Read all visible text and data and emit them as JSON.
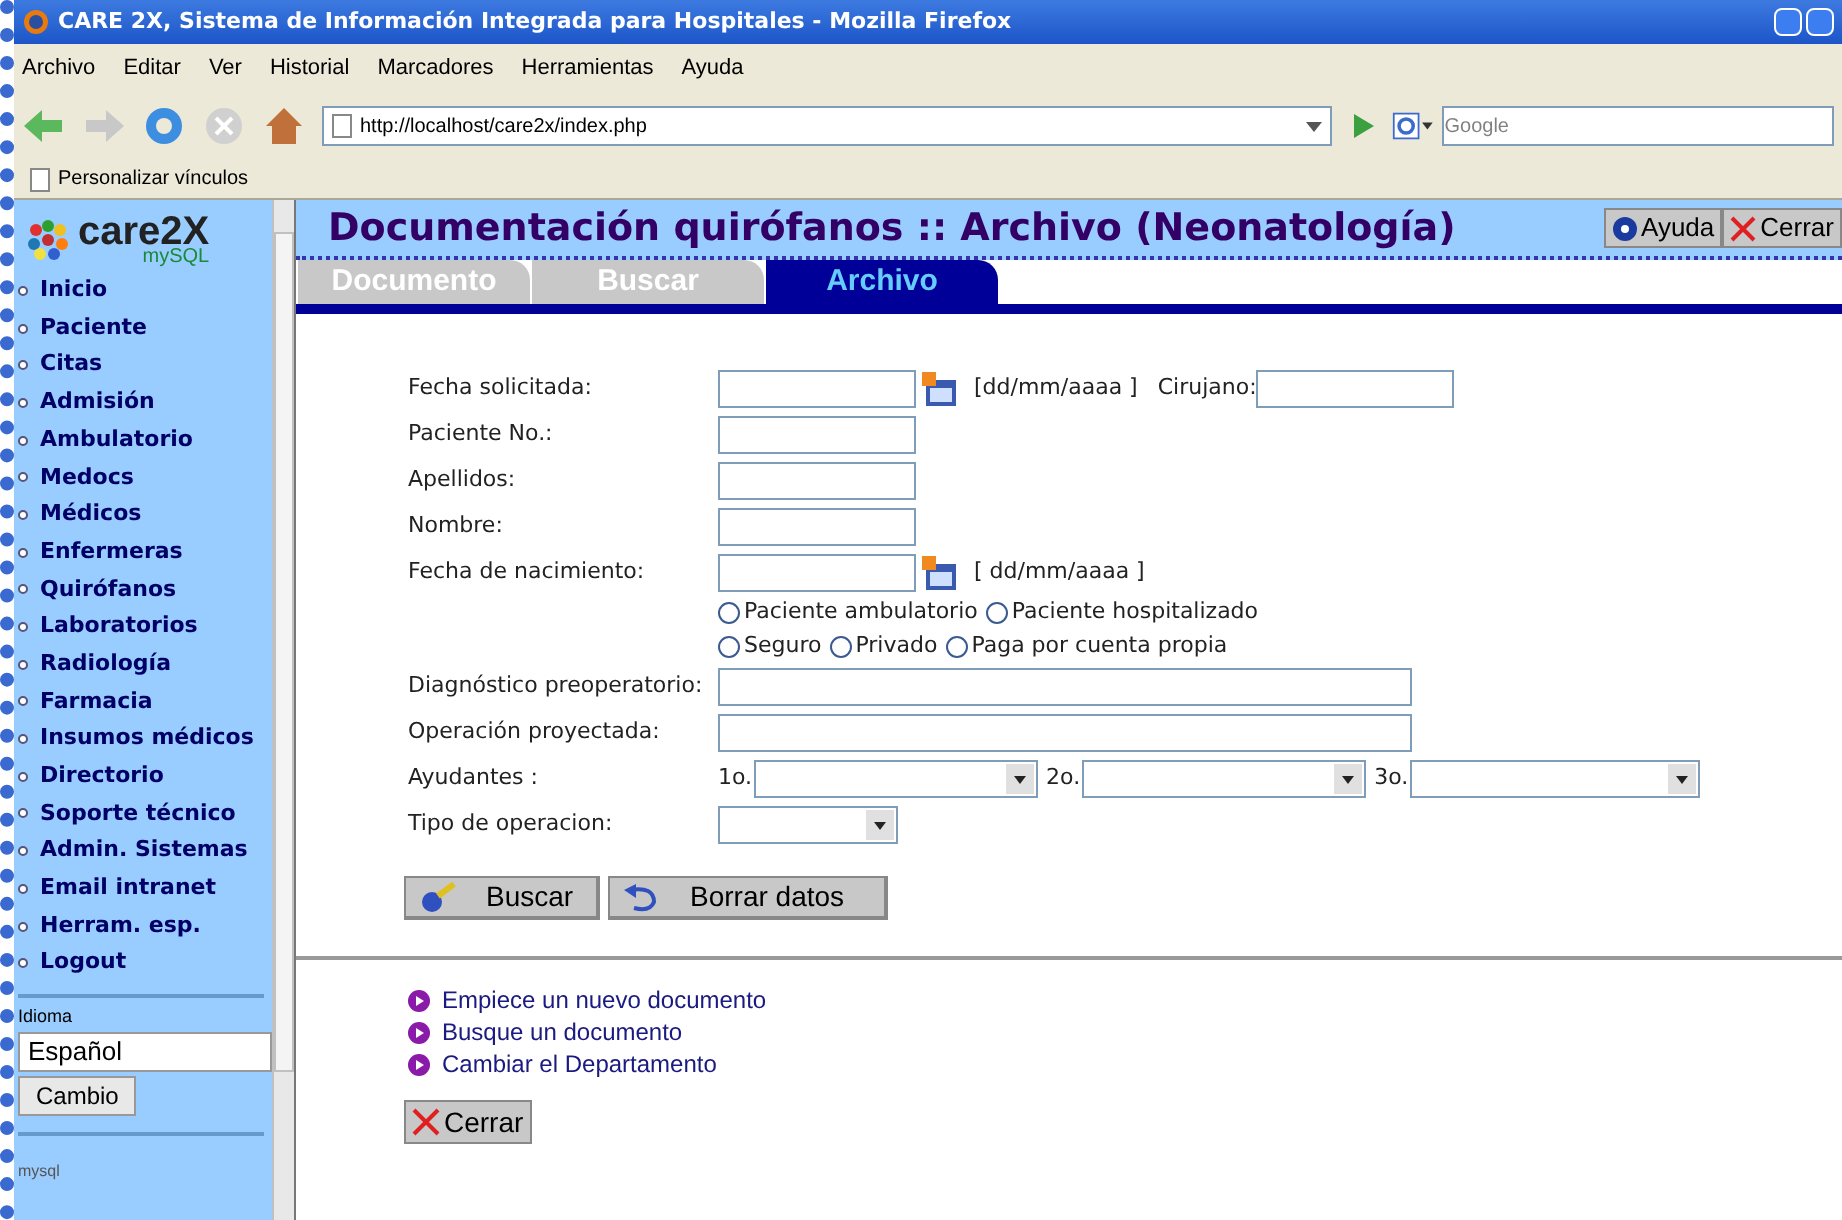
{
  "window": {
    "title": "CARE 2X, Sistema de Información Integrada para Hospitales - Mozilla Firefox"
  },
  "menu": [
    "Archivo",
    "Editar",
    "Ver",
    "Historial",
    "Marcadores",
    "Herramientas",
    "Ayuda"
  ],
  "address": {
    "value": "http://localhost/care2x/index.php"
  },
  "search": {
    "placeholder": "Google"
  },
  "bookmarks": [
    "Personalizar vínculos"
  ],
  "sidebar": {
    "logo": {
      "name": "care2X",
      "sub": "mySQL"
    },
    "items": [
      "Inicio",
      "Paciente",
      "Citas",
      "Admisión",
      "Ambulatorio",
      "Medocs",
      "Médicos",
      "Enfermeras",
      "Quirófanos",
      "Laboratorios",
      "Radiología",
      "Farmacia",
      "Insumos médicos",
      "Directorio",
      "Soporte técnico",
      "Admin. Sistemas",
      "Email intranet",
      "Herram. esp.",
      "Logout"
    ],
    "language_label": "Idioma",
    "language": "Español",
    "change_button": "Cambio",
    "footer": "mysql"
  },
  "header": {
    "title": "Documentación quirófanos :: Archivo (Neonatología)",
    "buttons": [
      {
        "kind": "help",
        "label": "Ayuda"
      },
      {
        "kind": "close",
        "label": "Cerrar"
      }
    ]
  },
  "tabs": [
    {
      "label": "Documento",
      "selected": false
    },
    {
      "label": "Buscar",
      "selected": false
    },
    {
      "label": "Archivo",
      "selected": true
    }
  ],
  "form": [
    {
      "kind": "date",
      "label": "Fecha solicitada:",
      "hint": "[dd/mm/aaaa ]",
      "extra_label": "Cirujano:"
    },
    {
      "kind": "text",
      "label": "Paciente No.:"
    },
    {
      "kind": "text",
      "label": "Apellidos:"
    },
    {
      "kind": "text",
      "label": "Nombre:"
    },
    {
      "kind": "date",
      "label": "Fecha de nacimiento:",
      "hint": "[ dd/mm/aaaa ]"
    },
    {
      "kind": "radios",
      "options": [
        {
          "label": "Paciente ambulatorio",
          "checked": false
        },
        {
          "label": "Paciente hospitalizado",
          "checked": false
        }
      ]
    },
    {
      "kind": "radios",
      "options": [
        {
          "label": "Seguro",
          "checked": false
        },
        {
          "label": "Privado",
          "checked": false
        },
        {
          "label": "Paga por cuenta propia",
          "checked": false
        }
      ]
    },
    {
      "kind": "wide",
      "label": "Diagnóstico preoperatorio:"
    },
    {
      "kind": "wide",
      "label": "Operación proyectada:"
    },
    {
      "kind": "selects",
      "label": "Ayudantes :",
      "selects": [
        "1o.",
        "2o.",
        "3o."
      ]
    },
    {
      "kind": "select",
      "label": "Tipo de operacion:"
    }
  ],
  "actions": [
    {
      "kind": "search",
      "label": "Buscar"
    },
    {
      "kind": "reset",
      "label": "Borrar datos"
    }
  ],
  "links": [
    "Empiece un nuevo documento",
    "Busque un documento",
    "Cambiar el Departamento"
  ],
  "close_button": "Cerrar"
}
